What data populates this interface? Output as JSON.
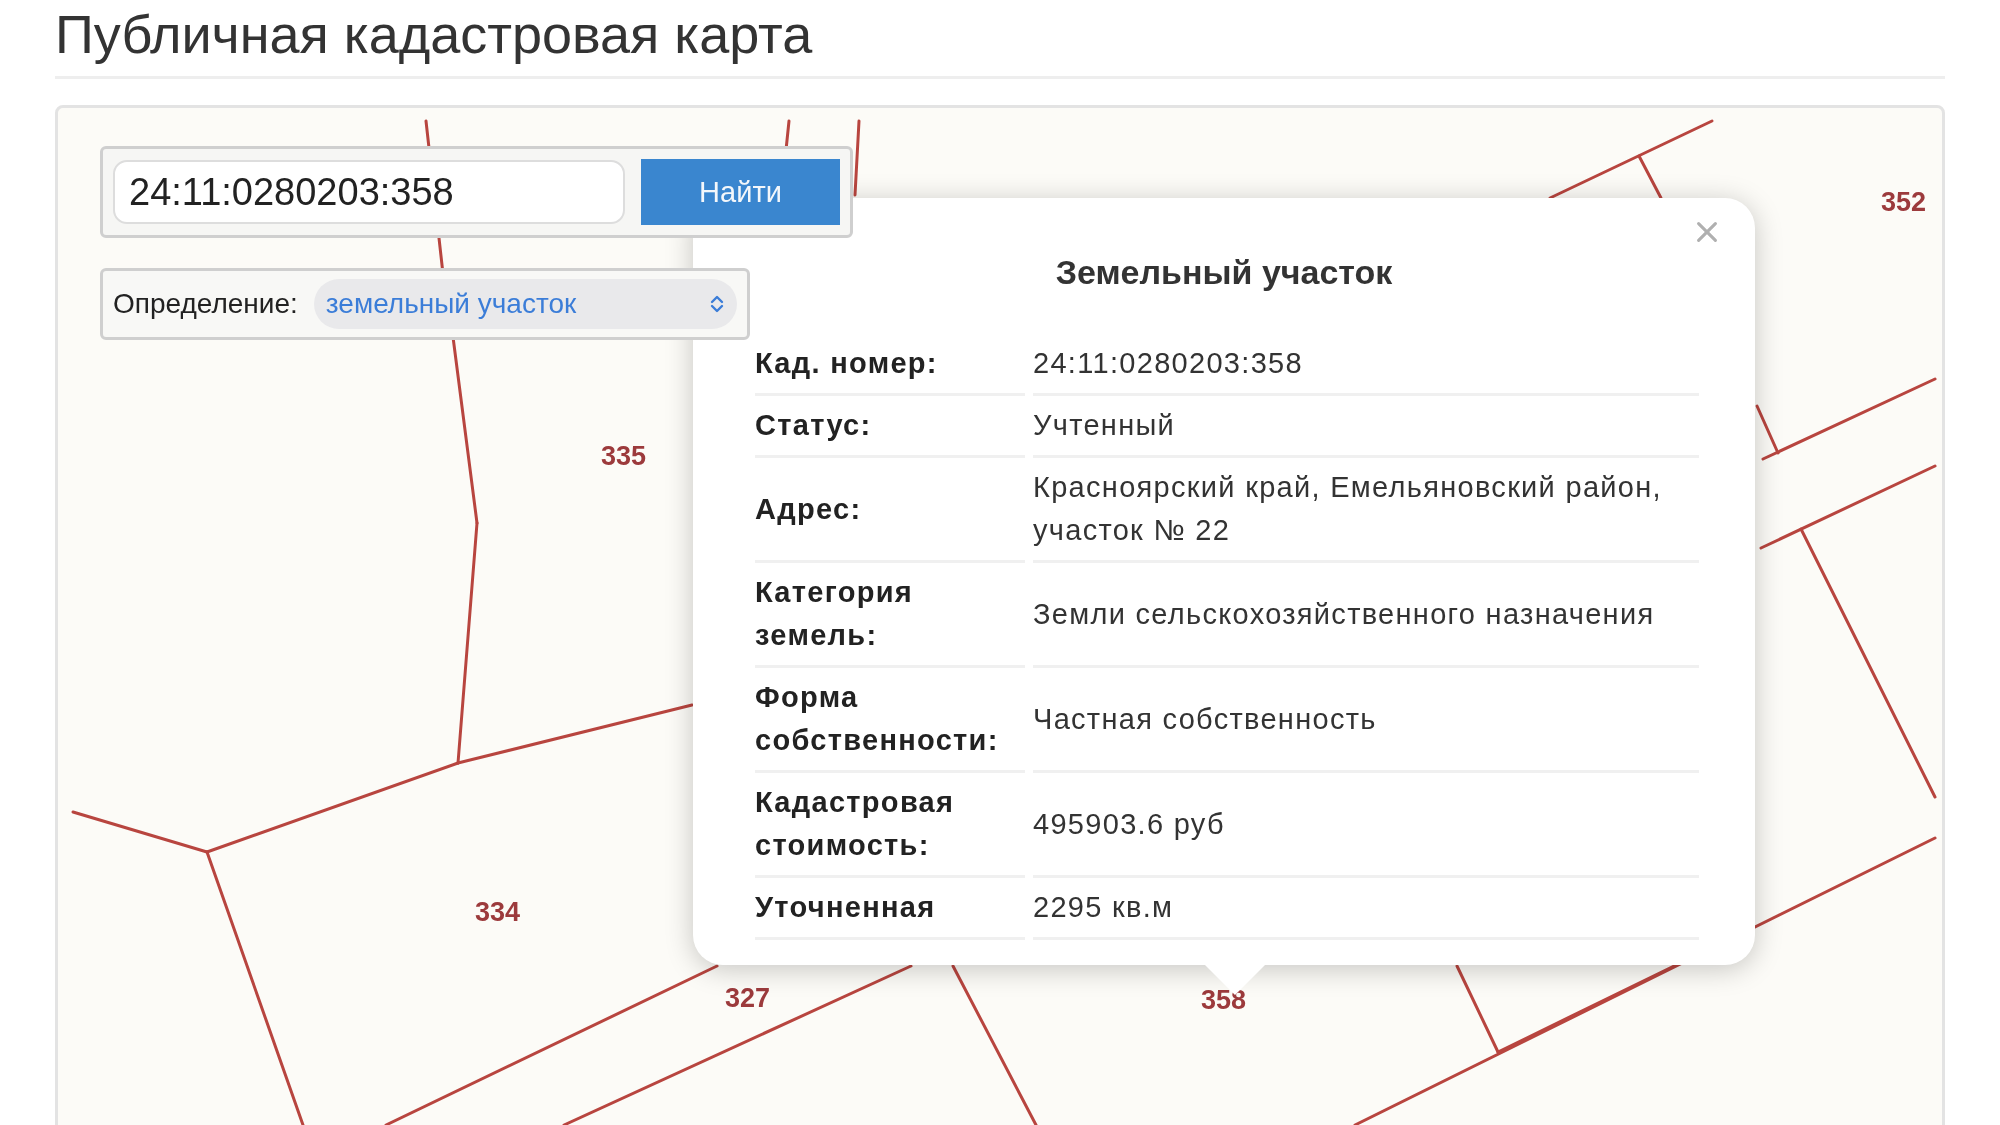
{
  "page_title": "Публичная кадастровая карта",
  "map": {
    "parcel_labels": [
      {
        "text": "352"
      },
      {
        "text": "335"
      },
      {
        "text": "334"
      },
      {
        "text": "327"
      },
      {
        "text": "358"
      }
    ]
  },
  "search": {
    "value": "24:11:0280203:358",
    "button": "Найти"
  },
  "definition": {
    "label": "Определение:",
    "value": "земельный участок"
  },
  "popup": {
    "title": "Земельный участок",
    "rows": [
      {
        "label": "Кад. номер:",
        "value": "24:11:0280203:358"
      },
      {
        "label": "Статус:",
        "value": "Учтенный"
      },
      {
        "label": "Адрес:",
        "value": "Красноярский край, Емельяновский район, участок № 22"
      },
      {
        "label": "Категория земель:",
        "value": "Земли сельскохозяйственного назначения"
      },
      {
        "label": "Форма собственности:",
        "value": "Частная собственность"
      },
      {
        "label": "Кадастровая стоимость:",
        "value": "495903.6 руб"
      },
      {
        "label": "Уточненная",
        "value": "2295 кв.м"
      }
    ]
  }
}
